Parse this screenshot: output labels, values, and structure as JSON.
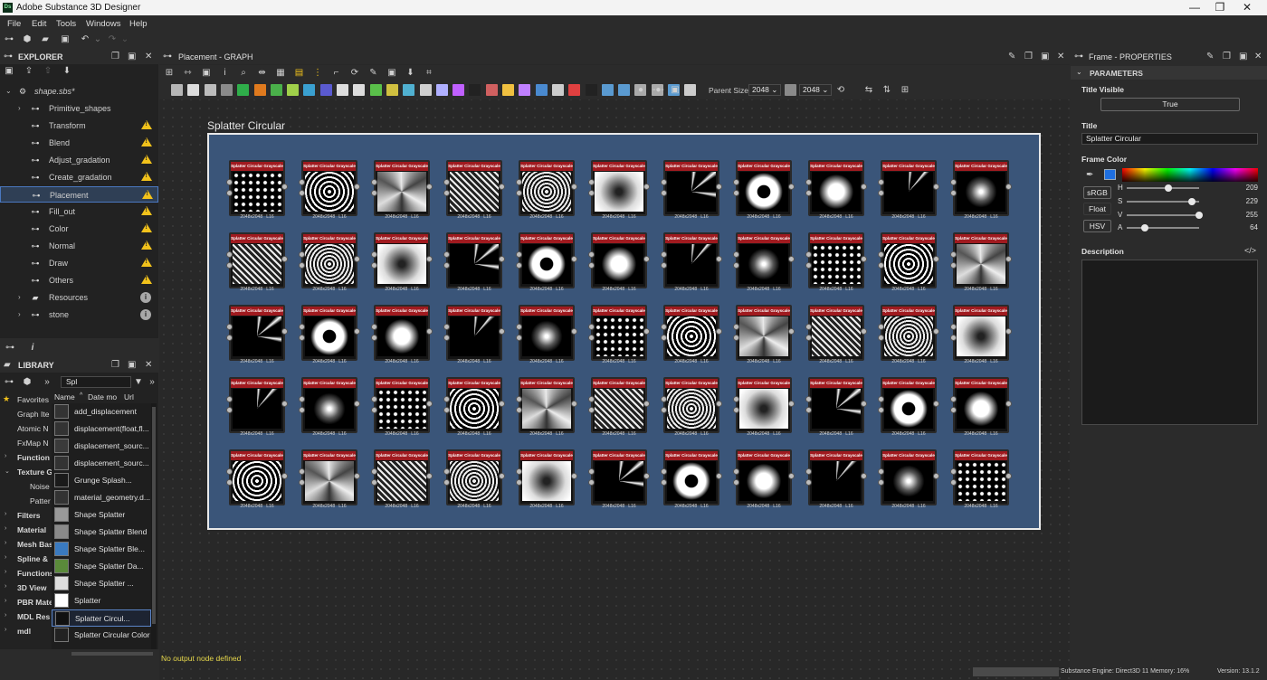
{
  "window": {
    "title": "Adobe Substance 3D Designer",
    "app_icon": "Ds"
  },
  "menu": [
    "File",
    "Edit",
    "Tools",
    "Windows",
    "Help"
  ],
  "explorer": {
    "title": "EXPLORER",
    "package": "shape.sbs*",
    "items": [
      {
        "label": "Primitive_shapes",
        "icon": "graph-icon",
        "status": "none",
        "arrow": "›"
      },
      {
        "label": "Transform",
        "icon": "graph-icon",
        "status": "warn",
        "arrow": ""
      },
      {
        "label": "Blend",
        "icon": "graph-icon",
        "status": "warn",
        "arrow": ""
      },
      {
        "label": "Adjust_gradation",
        "icon": "graph-icon",
        "status": "warn",
        "arrow": ""
      },
      {
        "label": "Create_gradation",
        "icon": "graph-icon",
        "status": "warn",
        "arrow": ""
      },
      {
        "label": "Placement",
        "icon": "graph-icon",
        "status": "warn",
        "arrow": "",
        "selected": true
      },
      {
        "label": "Fill_out",
        "icon": "graph-icon",
        "status": "warn",
        "arrow": ""
      },
      {
        "label": "Color",
        "icon": "graph-icon",
        "status": "warn",
        "arrow": ""
      },
      {
        "label": "Normal",
        "icon": "graph-icon",
        "status": "warn",
        "arrow": ""
      },
      {
        "label": "Draw",
        "icon": "graph-icon",
        "status": "warn",
        "arrow": ""
      },
      {
        "label": "Others",
        "icon": "graph-icon",
        "status": "warn",
        "arrow": ""
      },
      {
        "label": "Resources",
        "icon": "folder-icon",
        "status": "info",
        "arrow": "›"
      },
      {
        "label": "stone",
        "icon": "graph-icon",
        "status": "info",
        "arrow": "›"
      }
    ]
  },
  "library": {
    "title": "LIBRARY",
    "search": "Spl",
    "columns": [
      "Name",
      "Date mo",
      "Url"
    ],
    "categories": [
      {
        "label": "Favorites",
        "arrow": "★"
      },
      {
        "label": "Graph Ite",
        "arrow": ""
      },
      {
        "label": "Atomic N",
        "arrow": ""
      },
      {
        "label": "FxMap N",
        "arrow": ""
      },
      {
        "label": "Function",
        "arrow": "›"
      },
      {
        "label": "Texture G",
        "arrow": "⌄"
      },
      {
        "label": "Noise",
        "arrow": ""
      },
      {
        "label": "Patter",
        "arrow": ""
      },
      {
        "label": "Filters",
        "arrow": "›"
      },
      {
        "label": "Material",
        "arrow": "›"
      },
      {
        "label": "Mesh Bas",
        "arrow": "›"
      },
      {
        "label": "Spline &",
        "arrow": "›"
      },
      {
        "label": "Functions",
        "arrow": "›"
      },
      {
        "label": "3D View",
        "arrow": "›"
      },
      {
        "label": "PBR Mate",
        "arrow": "›"
      },
      {
        "label": "MDL Res",
        "arrow": "›"
      },
      {
        "label": "mdl",
        "arrow": "›"
      }
    ],
    "items": [
      {
        "label": "add_displacement"
      },
      {
        "label": "displacement(float,fl..."
      },
      {
        "label": "displacement_sourc..."
      },
      {
        "label": "displacement_sourc..."
      },
      {
        "label": "Grunge Splash..."
      },
      {
        "label": "material_geometry.d..."
      },
      {
        "label": "Shape Splatter"
      },
      {
        "label": "Shape Splatter Blend"
      },
      {
        "label": "Shape Splatter Ble..."
      },
      {
        "label": "Shape Splatter Da..."
      },
      {
        "label": "Shape Splatter ..."
      },
      {
        "label": "Splatter"
      },
      {
        "label": "Splatter Circul...",
        "selected": true
      },
      {
        "label": "Splatter Circular Color"
      }
    ]
  },
  "graph": {
    "title": "Placement - GRAPH",
    "frame_title": "Splatter Circular",
    "parent_size_label": "Parent Size:",
    "parent_size_w": "2048",
    "parent_size_h": "2048",
    "node_title": "Splatter Circular Grayscale",
    "node_caption_size": "2048x2048",
    "node_caption_fmt": "L16",
    "rows": 5,
    "cols": 11
  },
  "properties": {
    "title": "Frame - PROPERTIES",
    "section": "PARAMETERS",
    "title_visible_label": "Title Visible",
    "title_visible_value": "True",
    "title_label": "Title",
    "title_value": "Splatter Circular",
    "frame_color_label": "Frame Color",
    "mode_srgb": "sRGB",
    "mode_float": "Float",
    "mode_hsv": "HSV",
    "h_label": "H",
    "h_value": "209",
    "h_frac": 0.58,
    "s_label": "S",
    "s_value": "229",
    "s_frac": 0.9,
    "v_label": "V",
    "v_value": "255",
    "v_frac": 1.0,
    "a_label": "A",
    "a_value": "64",
    "a_frac": 0.25,
    "description_label": "Description",
    "accent_color": "#1e6fe0"
  },
  "status": {
    "message": "No output node defined",
    "engine": "Substance Engine: Direct3D 11  Memory: 16%",
    "version": "Version: 13.1.2"
  }
}
